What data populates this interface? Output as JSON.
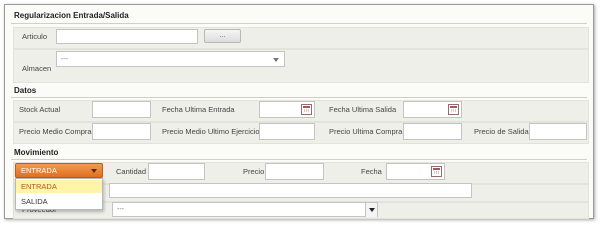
{
  "sections": {
    "regularizacion": "Regularizacion Entrada/Salida",
    "datos": "Datos",
    "movimiento": "Movimiento"
  },
  "regularizacion": {
    "articulo_label": "Articulo",
    "articulo_value": "",
    "browse_button": "...",
    "almacen_label": "Almacen",
    "almacen_value": "---"
  },
  "datos": {
    "stock_actual_label": "Stock Actual",
    "fecha_ultima_entrada_label": "Fecha Ultima Entrada",
    "fecha_ultima_salida_label": "Fecha Ultima Salida",
    "precio_medio_compra_label": "Precio Medio Compra",
    "precio_medio_ultimo_ejercicio_label": "Precio Medio Ultimo Ejercicio",
    "precio_ultima_compra_label": "Precio Ultima Compra",
    "precio_de_salida_label": "Precio de Salida"
  },
  "movimiento": {
    "tipo_selected": "ENTRADA",
    "tipo_options": [
      "ENTRADA",
      "SALIDA"
    ],
    "cantidad_label": "Cantidad",
    "precio_label": "Precio",
    "fecha_label": "Fecha",
    "proveedor_label": "Proveedor",
    "proveedor_value": "---"
  },
  "colors": {
    "dropdown_accent": "#e8782a",
    "highlight": "#fff4a8"
  }
}
